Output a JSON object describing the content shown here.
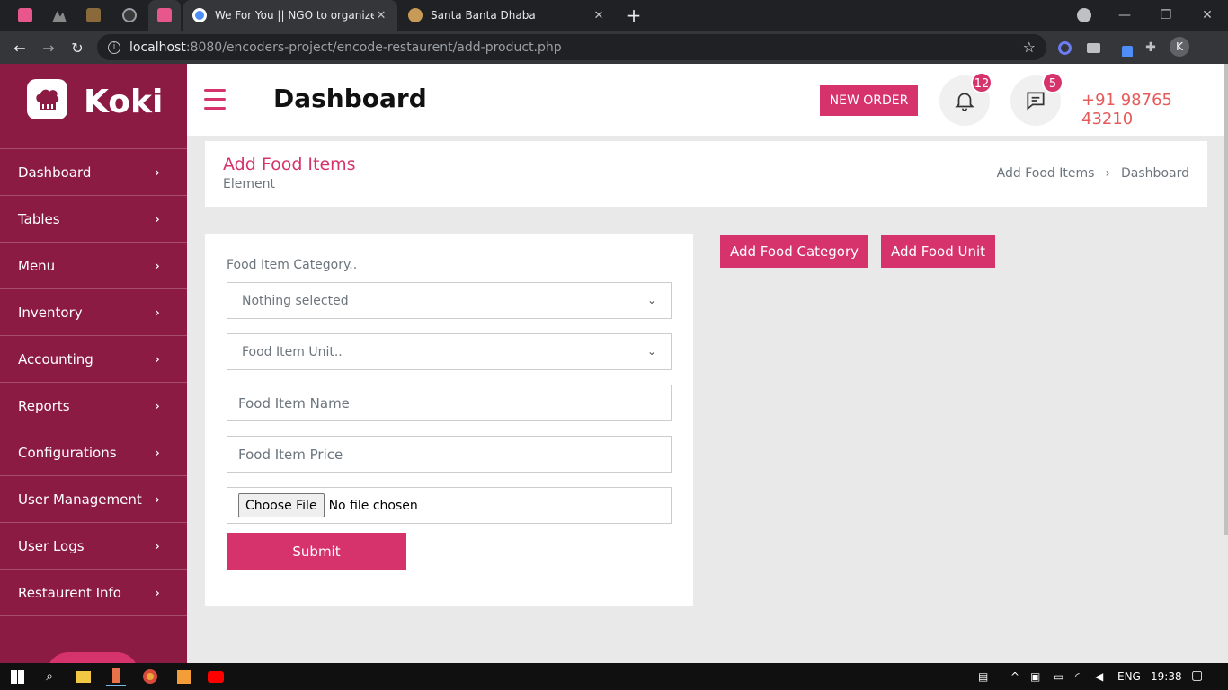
{
  "browser": {
    "tabs": [
      {
        "title": "We For You || NGO to organize Bl",
        "active": true
      },
      {
        "title": "Santa Banta Dhaba",
        "active": false
      }
    ],
    "new_tab": "+",
    "window": {
      "minimize": "—",
      "restore": "❐",
      "close": "✕"
    },
    "nav": {
      "back": "←",
      "forward": "→",
      "reload": "↻"
    },
    "url_host": "localhost",
    "url_path": ":8080/encoders-project/encode-restaurent/add-product.php",
    "profile_initial": "K"
  },
  "sidebar": {
    "brand": "Koki",
    "items": [
      {
        "label": "Dashboard"
      },
      {
        "label": "Tables"
      },
      {
        "label": "Menu"
      },
      {
        "label": "Inventory"
      },
      {
        "label": "Accounting"
      },
      {
        "label": "Reports"
      },
      {
        "label": "Configurations"
      },
      {
        "label": "User Management"
      },
      {
        "label": "User Logs"
      },
      {
        "label": "Restaurent Info"
      }
    ]
  },
  "header": {
    "title": "Dashboard",
    "new_order": "NEW ORDER",
    "notifications_count": "12",
    "messages_count": "5",
    "phone": "+91 98765 43210"
  },
  "breadcrumb": {
    "title": "Add Food Items",
    "subtitle": "Element",
    "items": [
      "Add Food Items",
      "Dashboard"
    ],
    "separator": "›"
  },
  "form": {
    "category_label": "Food Item Category..",
    "category_value": "Nothing selected",
    "unit_placeholder": "Food Item Unit..",
    "name_placeholder": "Food Item Name",
    "price_placeholder": "Food Item Price",
    "choose_file": "Choose File",
    "no_file": "No file chosen",
    "submit": "Submit"
  },
  "actions": {
    "add_category": "Add Food Category",
    "add_unit": "Add Food Unit"
  },
  "taskbar": {
    "lang": "ENG",
    "time": "19:38"
  },
  "colors": {
    "accent": "#d6336c",
    "sidebar": "#8c1b44",
    "phone": "#e55b5b"
  }
}
